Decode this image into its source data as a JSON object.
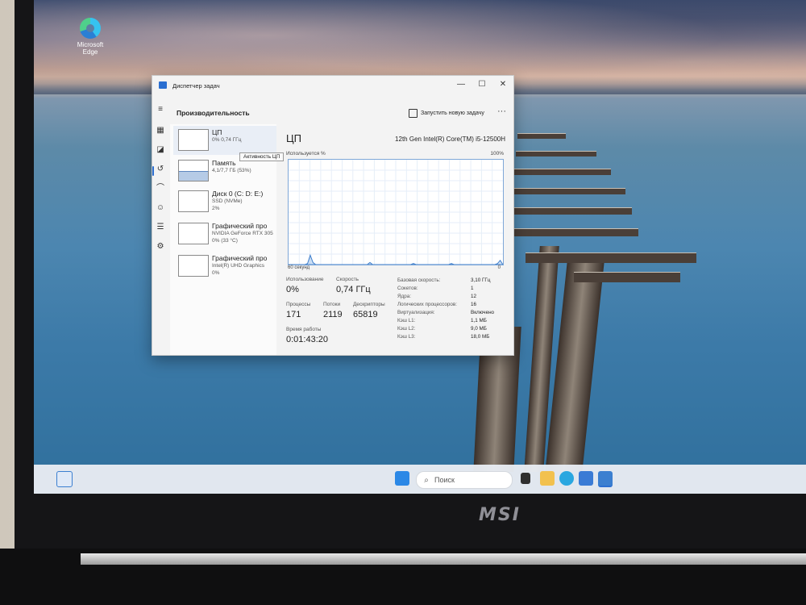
{
  "desktop": {
    "edge_icon_label_line1": "Microsoft",
    "edge_icon_label_line2": "Edge"
  },
  "window": {
    "title": "Диспетчер задач",
    "controls": {
      "minimize": "—",
      "maximize": "☐",
      "close": "✕"
    }
  },
  "header": {
    "title": "Производительность",
    "new_task_label": "Запустить новую задачу",
    "more_label": "···"
  },
  "tooltip": "Активность ЦП",
  "panels": [
    {
      "name": "ЦП",
      "sub1": "0% 0,74 ГГц",
      "sub2": ""
    },
    {
      "name": "Память",
      "sub1": "4,1/7,7 ГБ (53%)",
      "sub2": ""
    },
    {
      "name": "Диск 0 (C: D: E:)",
      "sub1": "SSD (NVMe)",
      "sub2": "2%"
    },
    {
      "name": "Графический про",
      "sub1": "NVIDIA GeForce RTX 305",
      "sub2": "0% (33 °C)"
    },
    {
      "name": "Графический про",
      "sub1": "Intel(R) UHD Graphics",
      "sub2": "0%"
    }
  ],
  "main": {
    "title": "ЦП",
    "cpu_model": "12th Gen Intel(R) Core(TM) i5-12500H",
    "graph_label": "Используется %",
    "graph_max": "100%",
    "graph_time": "60 секунд",
    "graph_min": "0",
    "graph_points": [
      0,
      0,
      0,
      0,
      0,
      0,
      0,
      1,
      9,
      2,
      0,
      0,
      0,
      0,
      0,
      0,
      0,
      0,
      0,
      0,
      0,
      0,
      0,
      0,
      0,
      0,
      0,
      0,
      0,
      0,
      2,
      0,
      0,
      0,
      0,
      0,
      0,
      0,
      0,
      0,
      0,
      0,
      0,
      0,
      0,
      0,
      1,
      0,
      0,
      0,
      0,
      0,
      0,
      0,
      0,
      0,
      0,
      0,
      0,
      0,
      1,
      0,
      0,
      0,
      0,
      0,
      0,
      0,
      0,
      0,
      0,
      0,
      0,
      0,
      0,
      0,
      0,
      1,
      4,
      0
    ],
    "stats": {
      "usage_label": "Использование",
      "usage_value": "0%",
      "speed_label": "Скорость",
      "speed_value": "0,74 ГГц",
      "processes_label": "Процессы",
      "processes_value": "171",
      "threads_label": "Потоки",
      "threads_value": "2119",
      "handles_label": "Дескрипторы",
      "handles_value": "65819",
      "uptime_label": "Время работы",
      "uptime_value": "0:01:43:20"
    },
    "specs": [
      {
        "key": "Базовая скорость:",
        "value": "3,10 ГГц"
      },
      {
        "key": "Сокетов:",
        "value": "1"
      },
      {
        "key": "Ядра:",
        "value": "12"
      },
      {
        "key": "Логических процессоров:",
        "value": "16"
      },
      {
        "key": "Виртуализация:",
        "value": "Включено"
      },
      {
        "key": "Кэш L1:",
        "value": "1,1 МБ"
      },
      {
        "key": "Кэш L2:",
        "value": "9,0 МБ"
      },
      {
        "key": "Кэш L3:",
        "value": "18,0 МБ"
      }
    ]
  },
  "taskbar": {
    "search_placeholder": "Поиск",
    "colors": {
      "start": "#2b88e6",
      "explorer": "#f2c14e",
      "edge": "#2aa7e0",
      "store": "#3a7bd5",
      "taskmgr": "#3b7fd0"
    }
  },
  "brand": "MSI",
  "icons": [
    "edge-icon",
    "hamburger-icon",
    "processes-icon",
    "performance-icon",
    "history-icon",
    "startup-icon",
    "users-icon",
    "details-icon",
    "services-icon",
    "settings-icon",
    "new-task-icon",
    "search-icon",
    "start-icon"
  ]
}
